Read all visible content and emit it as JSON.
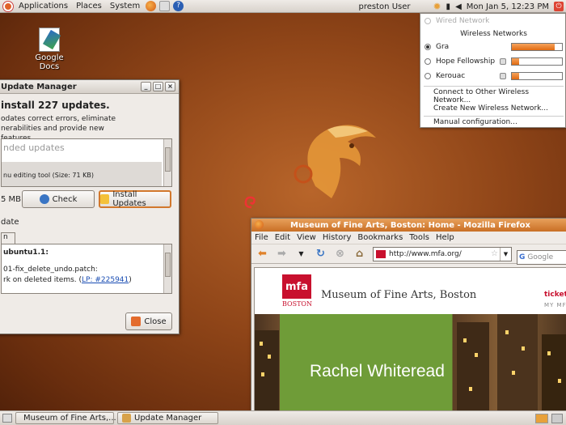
{
  "top_panel": {
    "menus": [
      "Applications",
      "Places",
      "System"
    ],
    "user": "preston User",
    "clock": "Mon Jan  5, 12:23 PM"
  },
  "desktop": {
    "icon_label": "Google Docs"
  },
  "update_manager": {
    "title": "Update Manager",
    "heading": "install 227 updates.",
    "description": "odates correct errors, eliminate nerabilities and provide new features.",
    "list_greyed": "nded updates",
    "list_item": "nu editing tool (Size: 71 KB)",
    "size": "5 MB",
    "check_label": "Check",
    "install_label": "Install Updates",
    "date_label": "date",
    "tab_label": "n",
    "desc_line1": "ubuntu1.1:",
    "desc_line2": "01-fix_delete_undo.patch:",
    "desc_line3": "rk on deleted items. (",
    "desc_link": "LP: #225941",
    "desc_close_paren": ")",
    "close_label": "Close"
  },
  "firefox": {
    "title": "Museum of Fine Arts, Boston: Home - Mozilla Firefox",
    "menus": [
      "File",
      "Edit",
      "View",
      "History",
      "Bookmarks",
      "Tools",
      "Help"
    ],
    "url": "http://www.mfa.org/",
    "search_placeholder": "Google",
    "site": {
      "logo": "mfa",
      "boston": "BOSTON",
      "name": "Museum of Fine Arts, Boston",
      "tickets": "tickets",
      "mymfa": "MY MF",
      "hero_text": "Rachel Whiteread"
    }
  },
  "network_menu": {
    "wired": "Wired Network",
    "wireless_header": "Wireless Networks",
    "networks": [
      {
        "name": "Gra",
        "selected": true,
        "signal": 0.85,
        "secured": false
      },
      {
        "name": "Hope Fellowship",
        "selected": false,
        "signal": 0.15,
        "secured": true
      },
      {
        "name": "Kerouac",
        "selected": false,
        "signal": 0.15,
        "secured": true
      }
    ],
    "connect_other": "Connect to Other Wireless Network...",
    "create_new": "Create New Wireless Network...",
    "manual": "Manual configuration..."
  },
  "taskbar": {
    "items": [
      "Museum of Fine Arts,...",
      "Update Manager"
    ]
  }
}
